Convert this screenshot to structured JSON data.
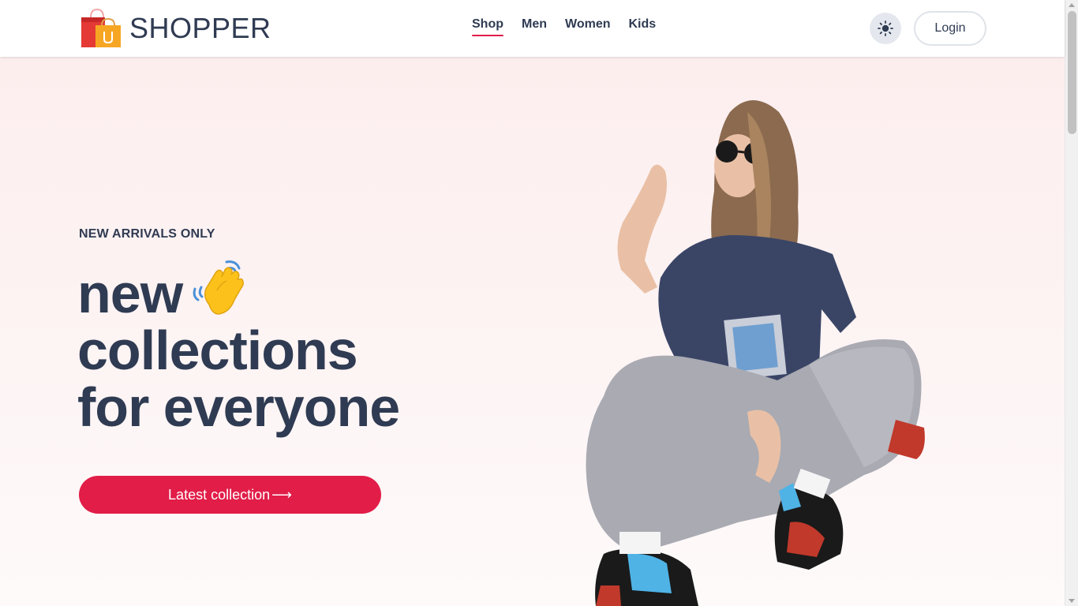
{
  "brand": {
    "name": "SHOPPER",
    "logo_icon": "shopping-bags-icon"
  },
  "nav": {
    "items": [
      {
        "label": "Shop",
        "active": true
      },
      {
        "label": "Men",
        "active": false
      },
      {
        "label": "Women",
        "active": false
      },
      {
        "label": "Kids",
        "active": false
      }
    ]
  },
  "header_actions": {
    "theme_icon": "sun-icon",
    "login_label": "Login"
  },
  "hero": {
    "eyebrow": "NEW ARRIVALS ONLY",
    "headline_line1": "new",
    "headline_line2": "collections",
    "headline_line3": "for everyone",
    "headline_icon": "waving-hand-icon",
    "cta_label": "Latest collection",
    "cta_arrow": "⟶",
    "image_icon": "hero-model-image"
  },
  "colors": {
    "accent": "#e11d48",
    "text": "#2f3b52",
    "hero_bg": "#fdeeee"
  }
}
